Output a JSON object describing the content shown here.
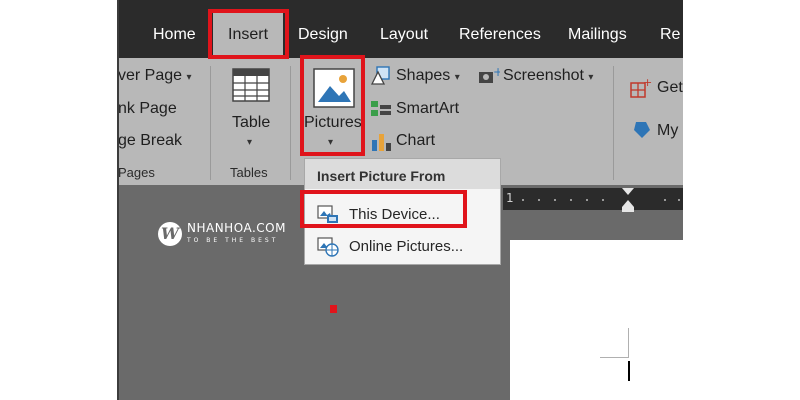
{
  "tabs": {
    "home": "Home",
    "insert": "Insert",
    "design": "Design",
    "layout": "Layout",
    "references": "References",
    "mailings": "Mailings",
    "review_partial": "Re"
  },
  "pages_group": {
    "cover_page": "ver Page",
    "blank_page": "nk Page",
    "page_break": "ge Break",
    "label": "Pages"
  },
  "tables_group": {
    "table": "Table",
    "label": "Tables"
  },
  "illustrations": {
    "pictures": "Pictures",
    "shapes": "Shapes",
    "smartart": "SmartArt",
    "chart": "Chart",
    "screenshot": "Screenshot"
  },
  "addins": {
    "get": "Get",
    "my": "My"
  },
  "menu": {
    "header": "Insert Picture From",
    "this_device": "This Device...",
    "online_pictures": "Online Pictures..."
  },
  "ruler": {
    "number": "1"
  },
  "watermark": {
    "initial": "W",
    "name": "NHANHOA.COM",
    "tagline": "TO BE THE BEST"
  },
  "colors": {
    "highlight": "#e0141b",
    "titlebar": "#2b2b2b",
    "ribbon": "#b8b8b8",
    "canvas": "#6a6a6a"
  }
}
